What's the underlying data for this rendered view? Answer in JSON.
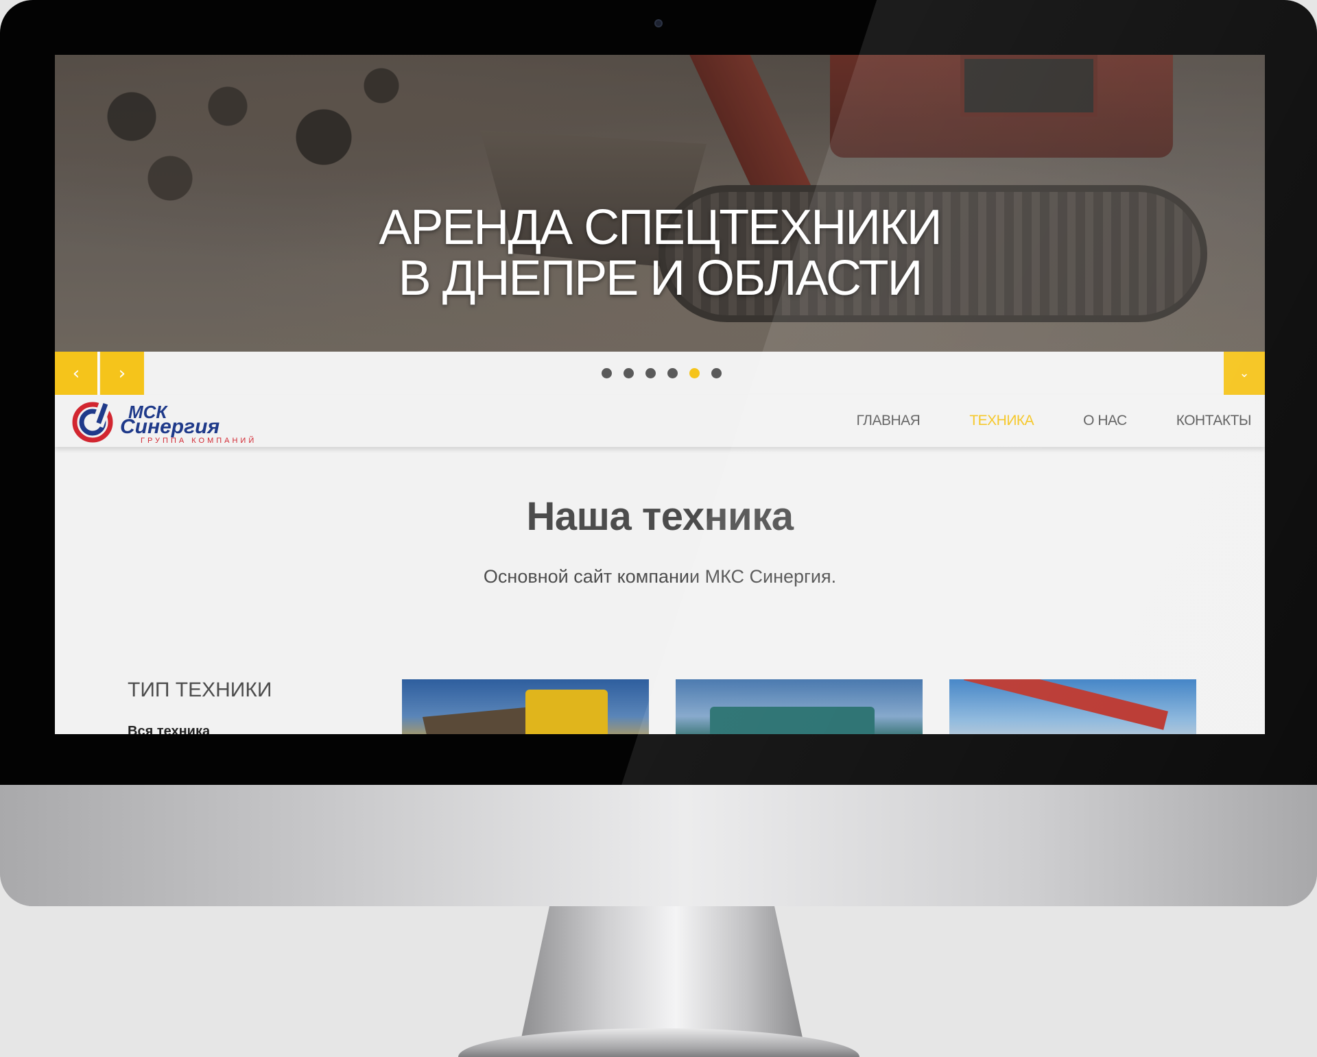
{
  "hero": {
    "title_line1": "АРЕНДА СПЕЦТЕХНИКИ",
    "title_line2": "В ДНЕПРЕ И ОБЛАСТИ"
  },
  "slider": {
    "prev_icon": "chevron-left-icon",
    "next_icon": "chevron-right-icon",
    "down_icon": "chevron-down-icon",
    "prev_glyph": "‹",
    "next_glyph": "›",
    "down_glyph": "⌄",
    "dot_count": 6,
    "active_dot": 5
  },
  "brand": {
    "line1": "МСК",
    "line2": "Синергия",
    "tagline": "ГРУППА КОМПАНИЙ",
    "primary_color": "#1f3a8a",
    "accent_color": "#d22630"
  },
  "nav": {
    "items": [
      {
        "label": "ГЛАВНАЯ",
        "active": false
      },
      {
        "label": "ТЕХНИКА",
        "active": true
      },
      {
        "label": "О НАС",
        "active": false
      },
      {
        "label": "КОНТАКТЫ",
        "active": false
      }
    ]
  },
  "content": {
    "title": "Наша техника",
    "subtitle": "Основной сайт компании МКС Синергия.",
    "filter_title": "ТИП ТЕХНИКИ",
    "filter_first": "Вся техника"
  },
  "colors": {
    "accent": "#f5c41b",
    "text": "#4c4c4c",
    "background": "#f2f2f2"
  }
}
